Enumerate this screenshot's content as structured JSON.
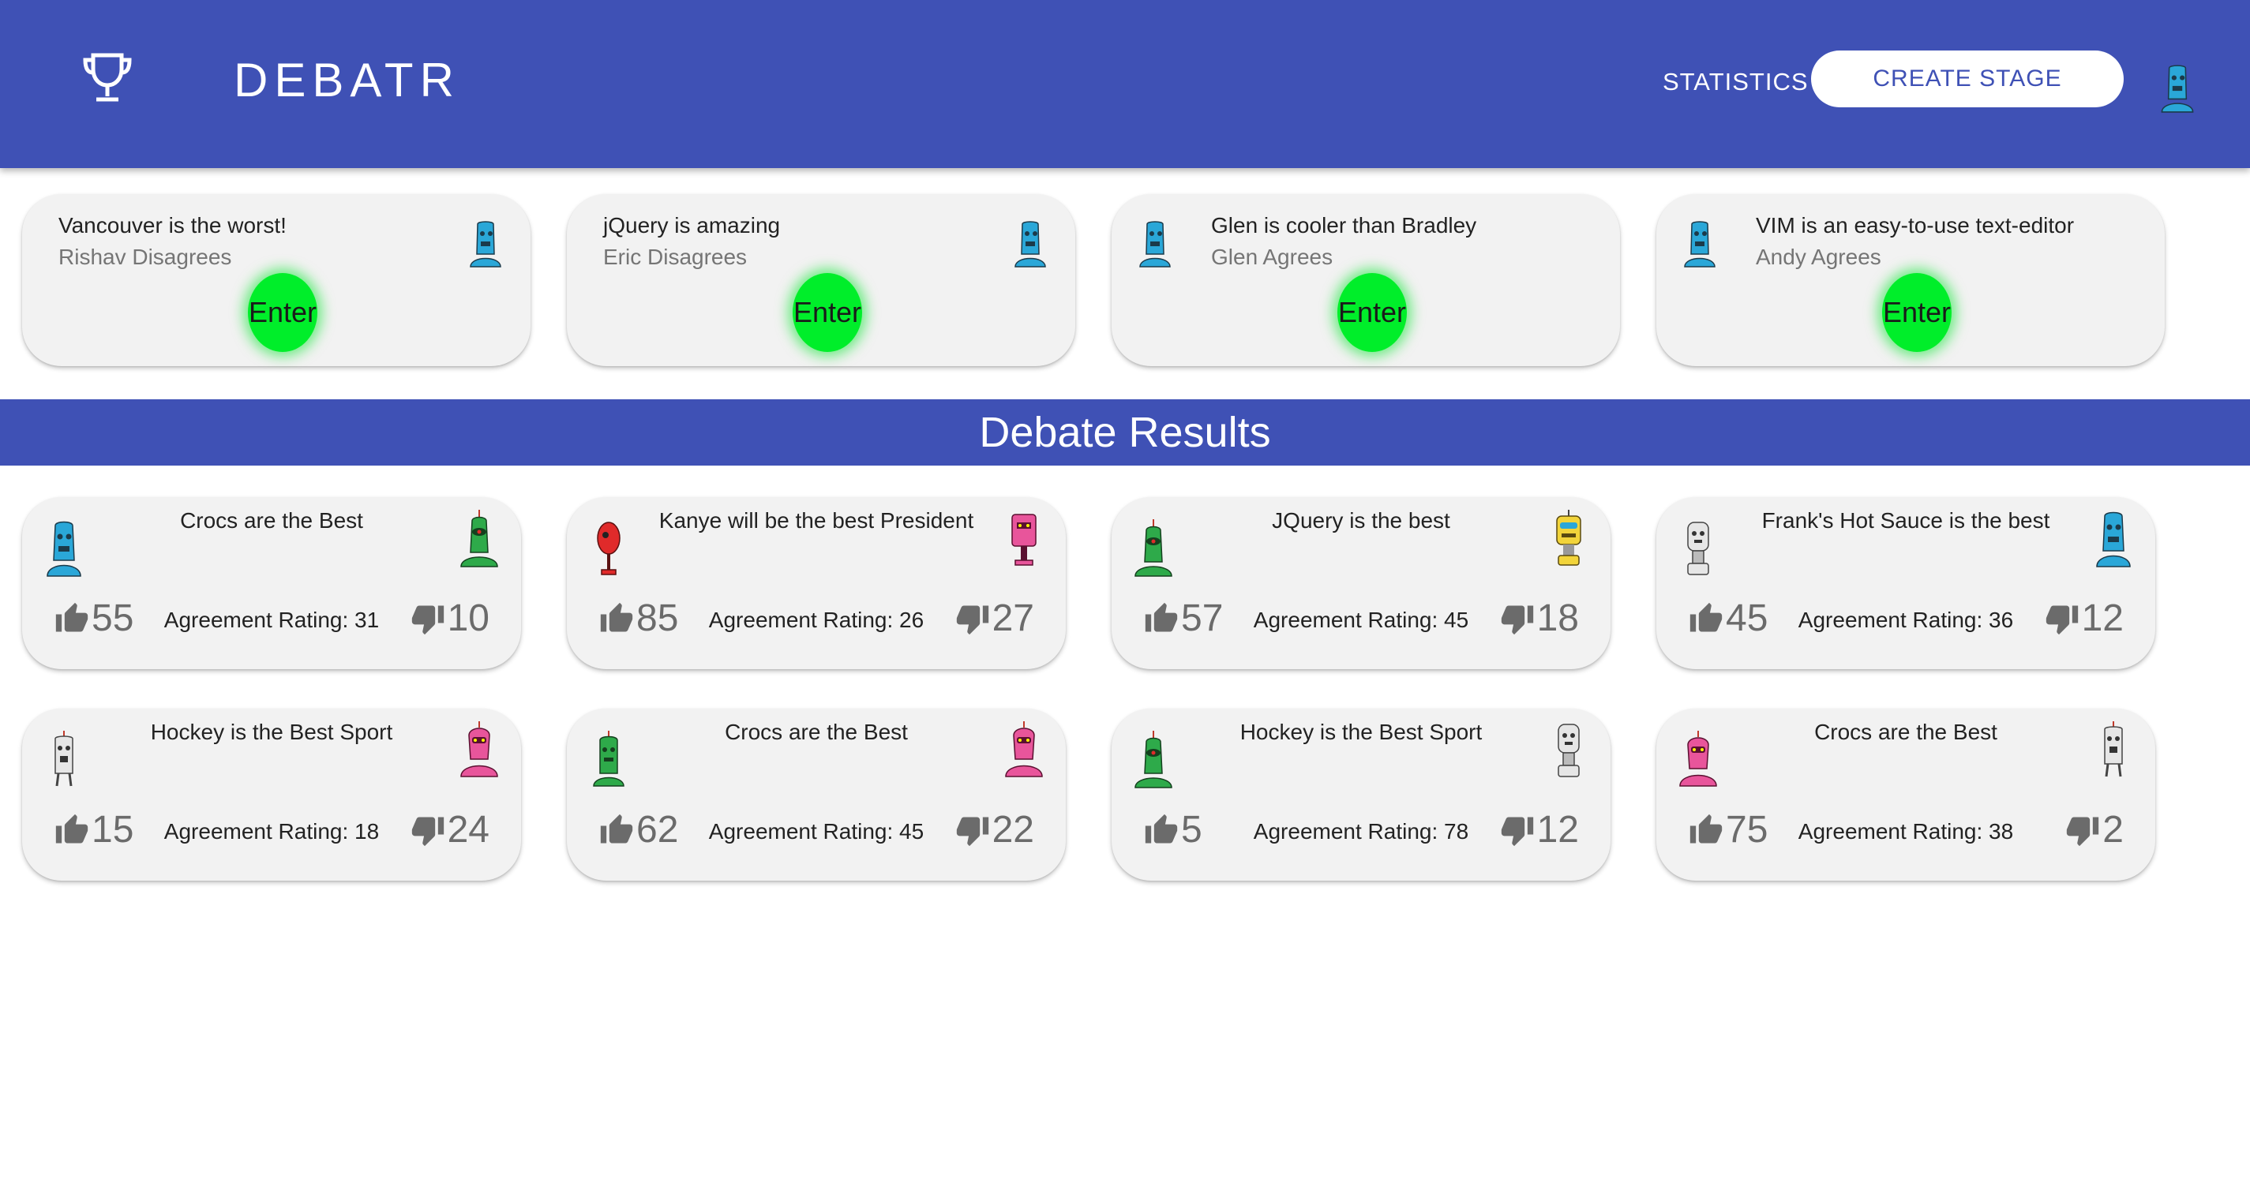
{
  "header": {
    "brand": "DEBATR",
    "statistics_label": "STATISTICS",
    "create_stage_label": "CREATE STAGE",
    "icon": "trophy-icon",
    "color": "#3f51b5"
  },
  "stages": [
    {
      "title": "Vancouver is the worst!",
      "subtitle": "Rishav Disagrees",
      "enter_label": "Enter"
    },
    {
      "title": "jQuery is amazing",
      "subtitle": "Eric Disagrees",
      "enter_label": "Enter"
    },
    {
      "title": "Glen is cooler than Bradley",
      "subtitle": "Glen Agrees",
      "enter_label": "Enter"
    },
    {
      "title": "VIM is an easy-to-use text-editor",
      "subtitle": "Andy Agrees",
      "enter_label": "Enter"
    }
  ],
  "results_heading": "Debate Results",
  "results": [
    {
      "title": "Crocs are the Best",
      "up": "55",
      "rating": "Agreement Rating: 31",
      "down": "10"
    },
    {
      "title": "Kanye will be the best President",
      "up": "85",
      "rating": "Agreement Rating: 26",
      "down": "27"
    },
    {
      "title": "JQuery is the best",
      "up": "57",
      "rating": "Agreement Rating: 45",
      "down": "18"
    },
    {
      "title": "Frank's Hot Sauce is the best",
      "up": "45",
      "rating": "Agreement Rating: 36",
      "down": "12"
    },
    {
      "title": "Hockey is the Best Sport",
      "up": "15",
      "rating": "Agreement Rating: 18",
      "down": "24"
    },
    {
      "title": "Crocs are the Best",
      "up": "62",
      "rating": "Agreement Rating: 45",
      "down": "22"
    },
    {
      "title": "Hockey is the Best Sport",
      "up": "5",
      "rating": "Agreement Rating: 78",
      "down": "12"
    },
    {
      "title": "Crocs are the Best",
      "up": "75",
      "rating": "Agreement Rating: 38",
      "down": "2"
    }
  ],
  "colors": {
    "primary": "#3f51b5",
    "enter": "#00ee2a",
    "card": "#f2f2f2",
    "robot_blue": "#2aa7d8",
    "robot_green": "#2eaa4a",
    "robot_red": "#e02a2a",
    "robot_pink": "#e8559b",
    "robot_yellow": "#f2d43a",
    "robot_white": "#e6e6e6"
  }
}
